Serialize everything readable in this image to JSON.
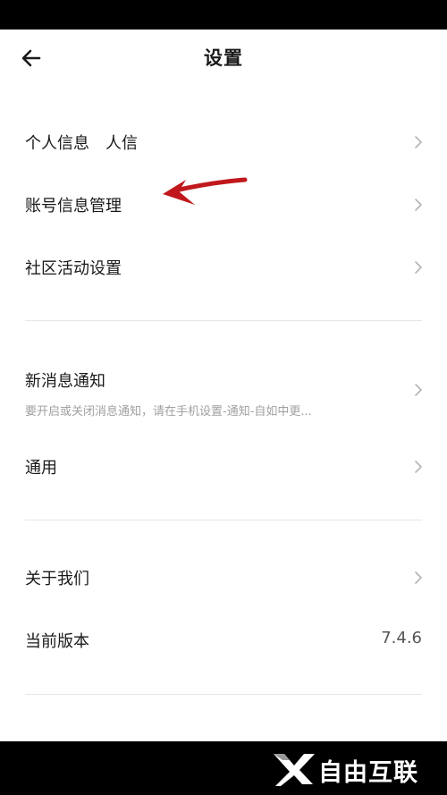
{
  "header": {
    "title": "设置"
  },
  "sections": {
    "personal_info": "个人信息",
    "personal_info_overlap": "人信",
    "account_info": "账号信息管理",
    "community_settings": "社区活动设置",
    "notifications": "新消息通知",
    "notifications_sub": "要开启或关闭消息通知，请在手机设置-通知-自如中更...",
    "general": "通用",
    "about_us": "关于我们",
    "current_version": "当前版本",
    "version_value": "7.4.6"
  },
  "watermark": {
    "text": "自由互联"
  },
  "colors": {
    "annotation_arrow": "#c0181c",
    "chevron": "#b5b5b5",
    "divider": "#e6e6e6",
    "watermark_logo": "#ffffff"
  },
  "icons": {
    "back": "arrow-left-icon",
    "chevron": "chevron-right-icon",
    "annotation": "red-arrow-icon"
  }
}
